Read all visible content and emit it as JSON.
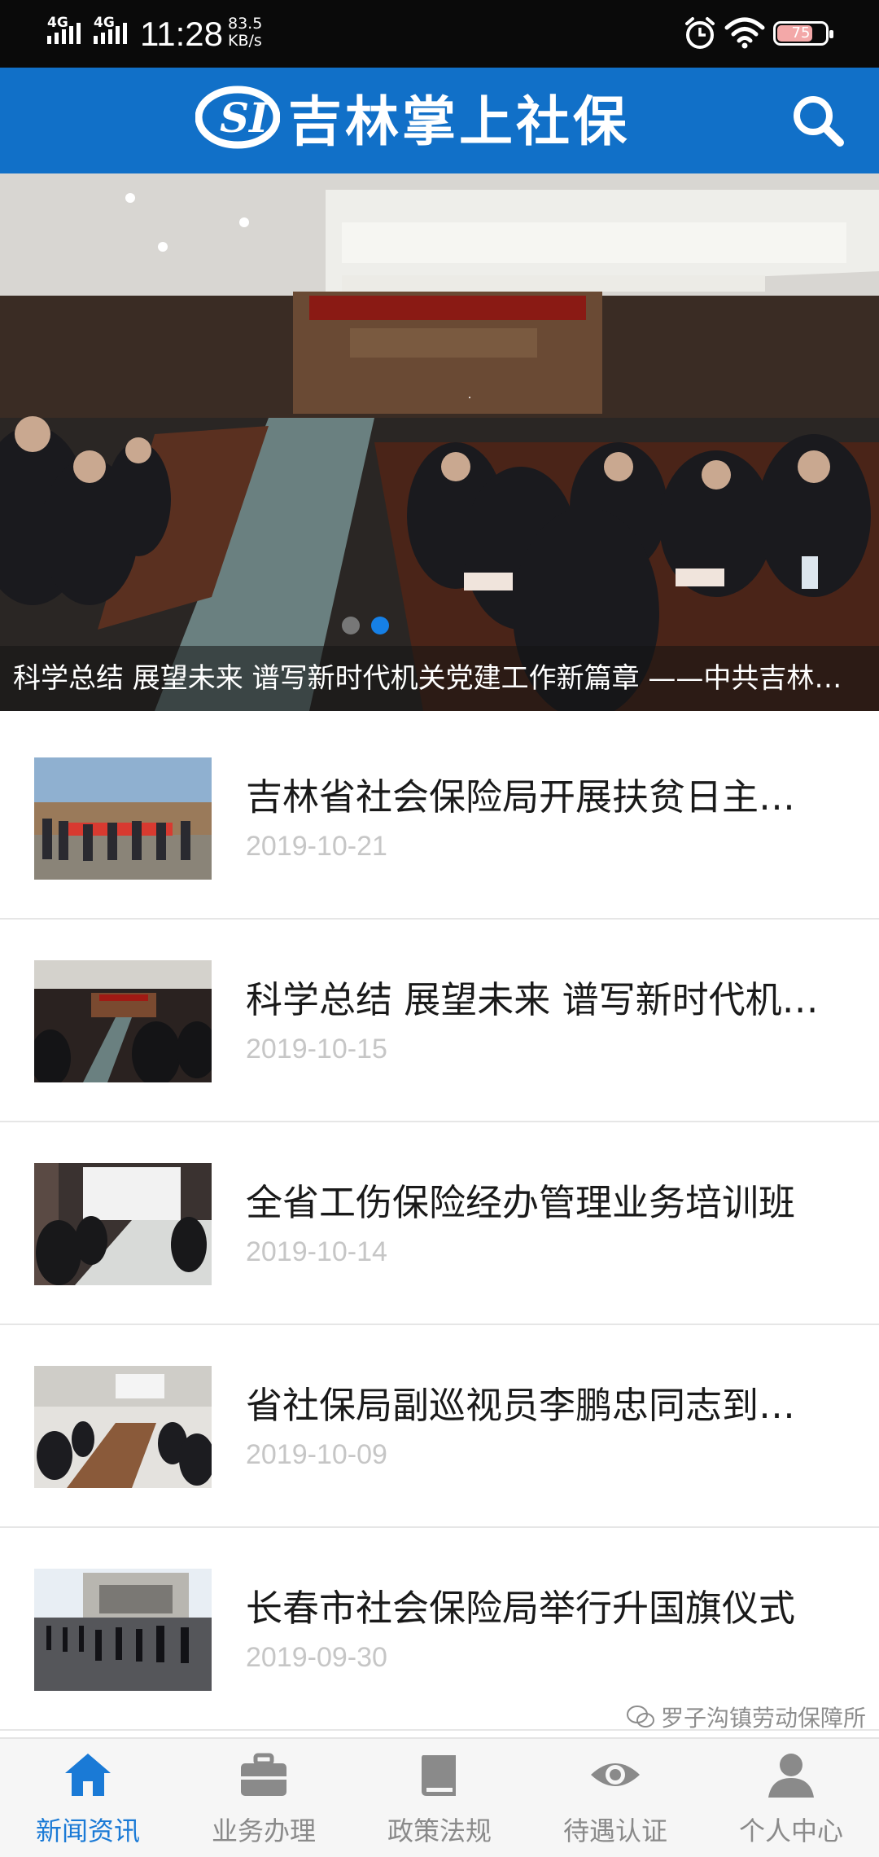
{
  "status_bar": {
    "network1": "4G",
    "network2": "4G",
    "time": "11:28",
    "speed_value": "83.5",
    "speed_unit": "KB/s",
    "battery_level": "75",
    "battery_fraction": 0.75
  },
  "header": {
    "title": "吉林掌上社保",
    "logo_text": "SI"
  },
  "banner": {
    "caption": "科学总结 展望未来 谱写新时代机关党建工作新篇章 ——中共吉林省社会保险事业管理局机关第六次大会",
    "slide_count": 2,
    "active_slide": 2
  },
  "news": [
    {
      "title": "吉林省社会保险局开展扶贫日主题活动",
      "date": "2019-10-21"
    },
    {
      "title": "科学总结 展望未来 谱写新时代机关党建工作新篇章",
      "date": "2019-10-15"
    },
    {
      "title": "全省工伤保险经办管理业务培训班",
      "date": "2019-10-14"
    },
    {
      "title": "省社保局副巡视员李鹏忠同志到长春调研",
      "date": "2019-10-09"
    },
    {
      "title": "长春市社会保险局举行升国旗仪式",
      "date": "2019-09-30"
    }
  ],
  "bottom_nav": [
    {
      "label": "新闻资讯",
      "icon": "home-icon",
      "active": true
    },
    {
      "label": "业务办理",
      "icon": "briefcase-icon",
      "active": false
    },
    {
      "label": "政策法规",
      "icon": "book-icon",
      "active": false
    },
    {
      "label": "待遇认证",
      "icon": "eye-icon",
      "active": false
    },
    {
      "label": "个人中心",
      "icon": "user-icon",
      "active": false
    }
  ],
  "watermark": "罗子沟镇劳动保障所",
  "colors": {
    "header_blue": "#1170c8",
    "accent_blue": "#1a7ad6",
    "date_gray": "#c6c6c6"
  }
}
